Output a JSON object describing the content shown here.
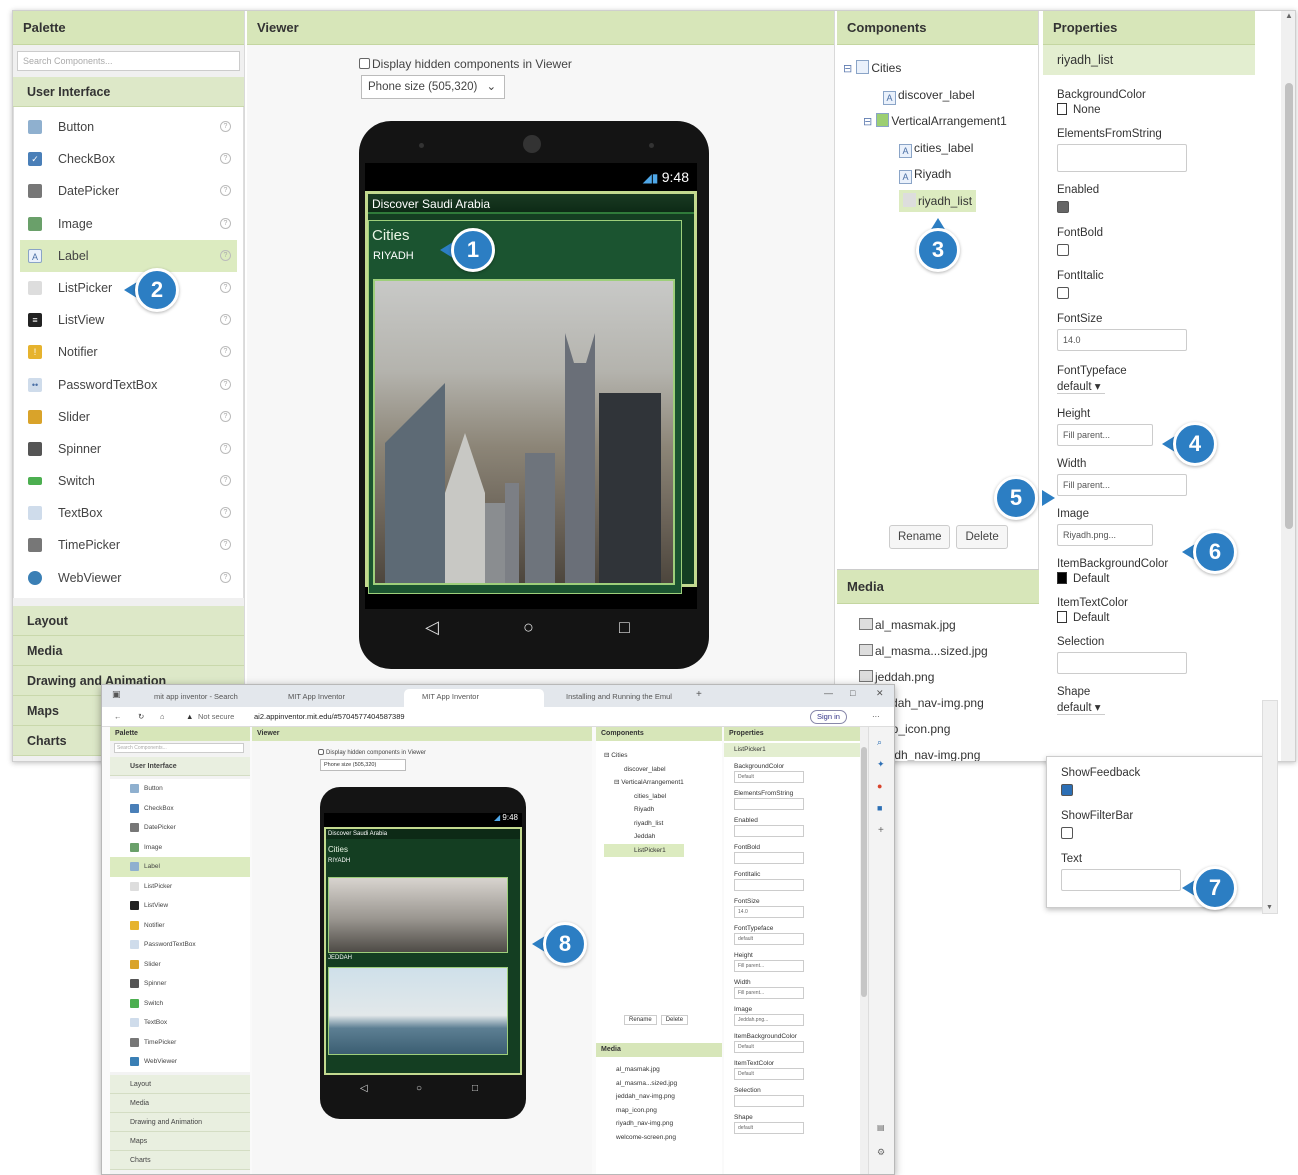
{
  "palette": {
    "title": "Palette",
    "search_placeholder": "Search Components...",
    "user_interface": "User Interface",
    "items": [
      "Button",
      "CheckBox",
      "DatePicker",
      "Image",
      "Label",
      "ListPicker",
      "ListView",
      "Notifier",
      "PasswordTextBox",
      "Slider",
      "Spinner",
      "Switch",
      "TextBox",
      "TimePicker",
      "WebViewer"
    ],
    "help": "?",
    "categories": [
      "Layout",
      "Media",
      "Drawing and Animation",
      "Maps",
      "Charts"
    ]
  },
  "viewer": {
    "title": "Viewer",
    "display_hidden": "Display hidden components in Viewer",
    "phone_size": "Phone size (505,320)",
    "time": "9:48",
    "app_title": "Discover Saudi Arabia",
    "cities": "Cities",
    "riyadh": "RIYADH",
    "nav_back": "◁",
    "nav_home": "○",
    "nav_recent": "□"
  },
  "components": {
    "title": "Components",
    "tree": [
      "Cities",
      "discover_label",
      "VerticalArrangement1",
      "cities_label",
      "Riyadh",
      "riyadh_list"
    ],
    "rename": "Rename",
    "delete": "Delete"
  },
  "media": {
    "title": "Media",
    "files": [
      "al_masmak.jpg",
      "al_masma...sized.jpg",
      "jeddah.png",
      "jeddah_nav-img.png",
      "map_icon.png",
      "riyadh_nav-img.png"
    ]
  },
  "properties": {
    "title": "Properties",
    "component": "riyadh_list",
    "background_color_label": "BackgroundColor",
    "background_color_value": "None",
    "elements_label": "ElementsFromString",
    "enabled_label": "Enabled",
    "fontbold_label": "FontBold",
    "fontitalic_label": "FontItalic",
    "fontsize_label": "FontSize",
    "fontsize_value": "14.0",
    "typeface_label": "FontTypeface",
    "typeface_value": "default",
    "height_label": "Height",
    "height_value": "Fill parent...",
    "width_label": "Width",
    "width_value": "Fill parent...",
    "image_label": "Image",
    "image_value": "Riyadh.png...",
    "item_bg_label": "ItemBackgroundColor",
    "item_bg_value": "Default",
    "item_text_label": "ItemTextColor",
    "item_text_value": "Default",
    "selection_label": "Selection",
    "shape_label": "Shape",
    "shape_value": "default",
    "showfeedback_label": "ShowFeedback",
    "showfilterbar_label": "ShowFilterBar",
    "text_label": "Text"
  },
  "inset": {
    "tabs": [
      "mit app inventor - Search",
      "MIT App Inventor",
      "MIT App Inventor",
      "Installing and Running the Emul"
    ],
    "not_secure": "Not secure",
    "url": "ai2.appinventor.mit.edu/#5704577404587389",
    "sign_in": "Sign in",
    "palette": "Palette",
    "viewer": "Viewer",
    "components": "Components",
    "properties": "Properties",
    "search": "Search Components...",
    "user_interface": "User Interface",
    "items": [
      "Button",
      "CheckBox",
      "DatePicker",
      "Image",
      "Label",
      "ListPicker",
      "ListView",
      "Notifier",
      "PasswordTextBox",
      "Slider",
      "Spinner",
      "Switch",
      "TextBox",
      "TimePicker",
      "WebViewer"
    ],
    "categories": [
      "Layout",
      "Media",
      "Drawing and Animation",
      "Maps",
      "Charts"
    ],
    "display_hidden": "Display hidden components in Viewer",
    "phone_size": "Phone size (505,320)",
    "time": "9:48",
    "app_title": "Discover Saudi Arabia",
    "cities": "Cities",
    "riyadh": "RIYADH",
    "jeddah": "JEDDAH",
    "tree": [
      "Cities",
      "discover_label",
      "VerticalArrangement1",
      "cities_label",
      "Riyadh",
      "riyadh_list",
      "Jeddah",
      "ListPicker1"
    ],
    "rename": "Rename",
    "delete": "Delete",
    "media": "Media",
    "media_files": [
      "al_masmak.jpg",
      "al_masma...sized.jpg",
      "jeddah_nav-img.png",
      "map_icon.png",
      "riyadh_nav-img.png",
      "welcome-screen.png"
    ],
    "prop_component": "ListPicker1",
    "props": [
      {
        "label": "BackgroundColor",
        "value": "Default"
      },
      {
        "label": "ElementsFromString",
        "value": ""
      },
      {
        "label": "Enabled",
        "value": ""
      },
      {
        "label": "FontBold",
        "value": ""
      },
      {
        "label": "FontItalic",
        "value": ""
      },
      {
        "label": "FontSize",
        "value": "14.0"
      },
      {
        "label": "FontTypeface",
        "value": "default"
      },
      {
        "label": "Height",
        "value": "Fill parent..."
      },
      {
        "label": "Width",
        "value": "Fill parent..."
      },
      {
        "label": "Image",
        "value": "Jeddah.png..."
      },
      {
        "label": "ItemBackgroundColor",
        "value": "Default"
      },
      {
        "label": "ItemTextColor",
        "value": "Default"
      },
      {
        "label": "Selection",
        "value": ""
      },
      {
        "label": "Shape",
        "value": "default"
      }
    ]
  },
  "markers": [
    "1",
    "2",
    "3",
    "4",
    "5",
    "6",
    "7",
    "8"
  ],
  "colors": {
    "header": "#d7e6b9",
    "marker": "#2c7ec3",
    "app_green": "#1b5430"
  }
}
